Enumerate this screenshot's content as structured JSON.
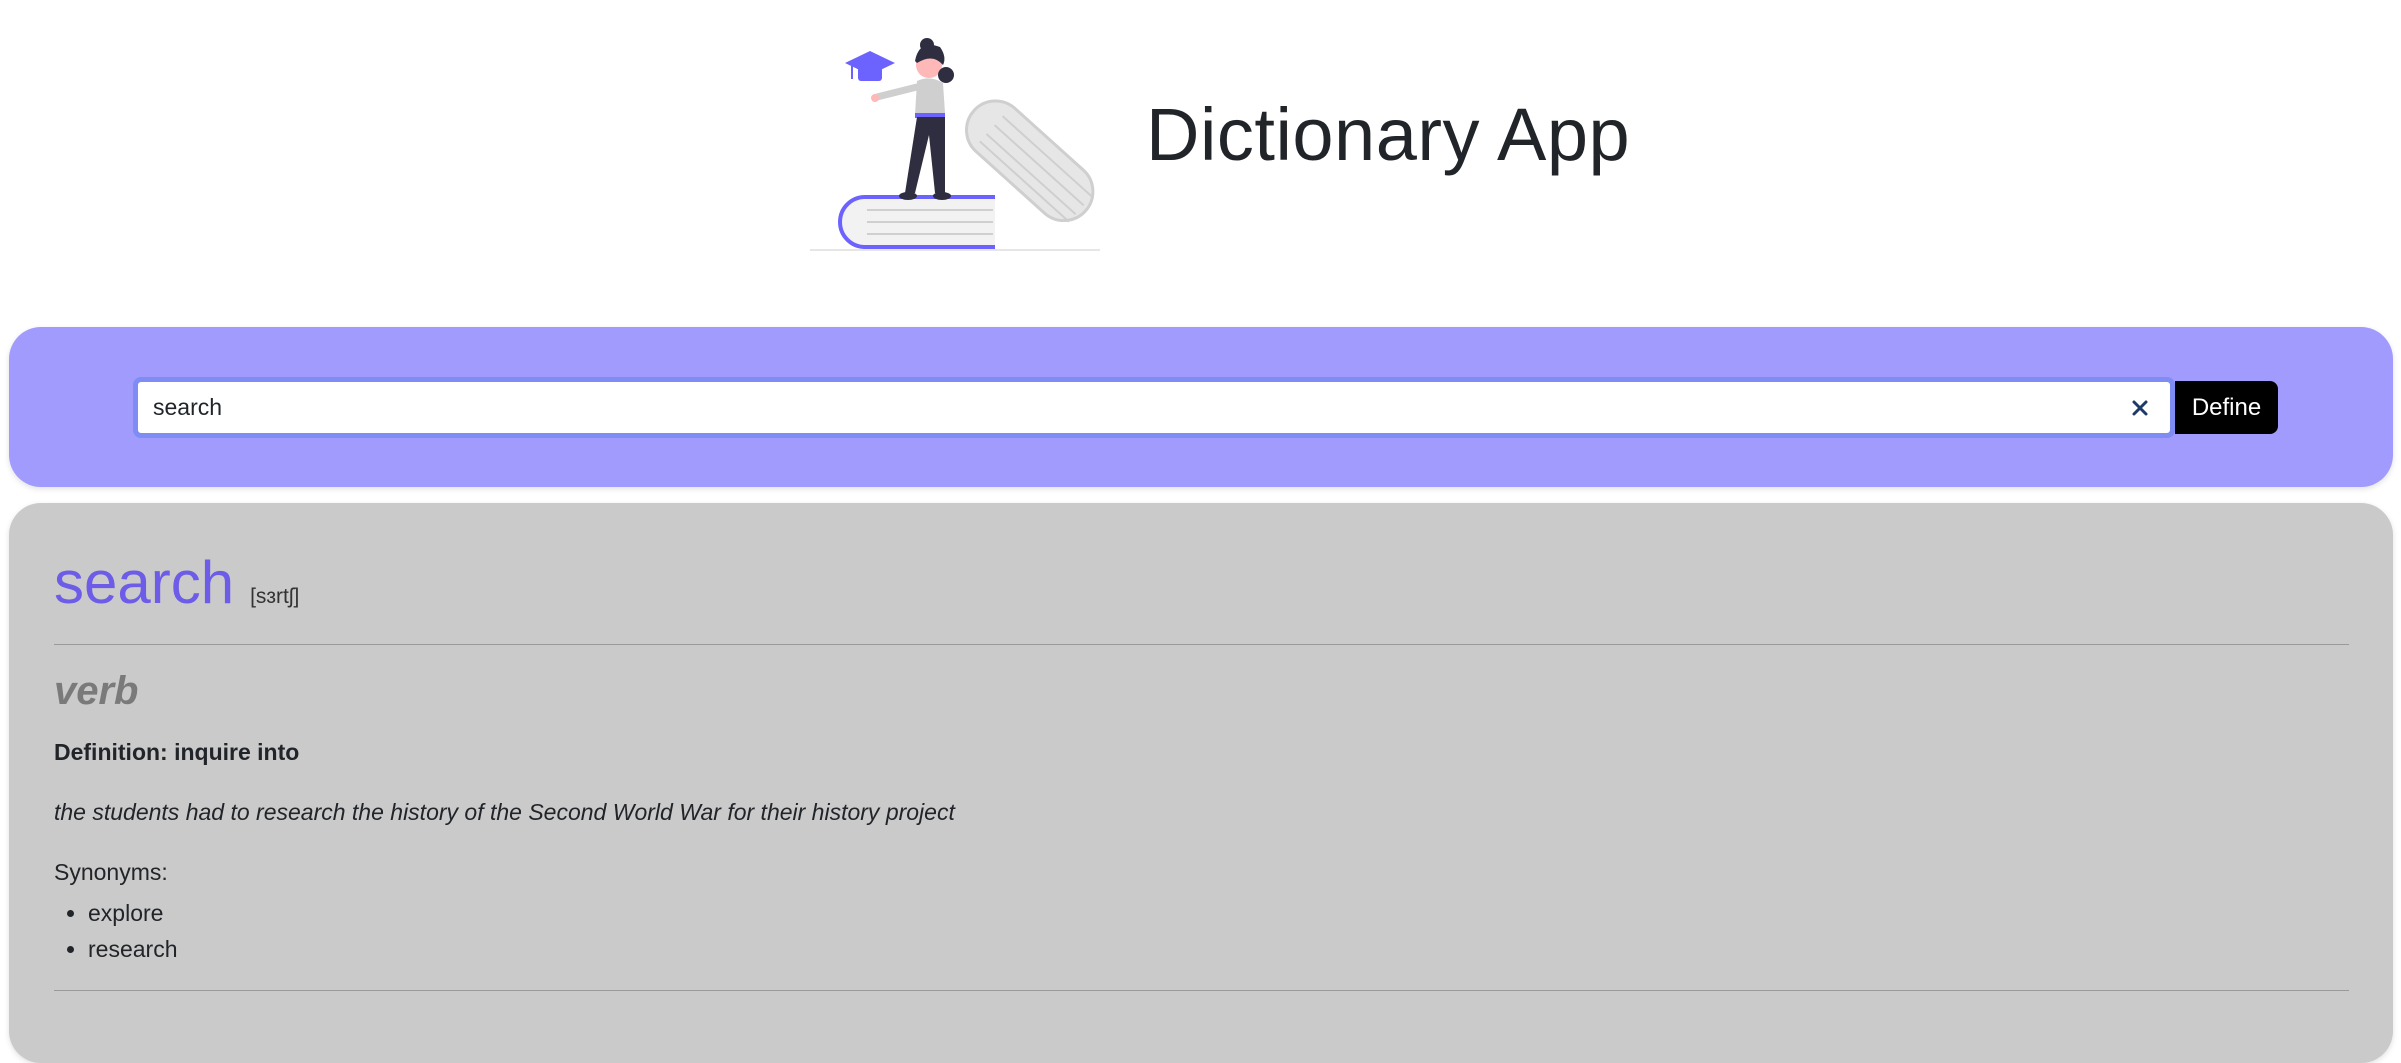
{
  "header": {
    "title": "Dictionary App",
    "illustration_icon": "student-on-books-illustration"
  },
  "search": {
    "value": "search",
    "placeholder": "",
    "clear_icon": "close-icon",
    "define_label": "Define"
  },
  "result": {
    "word": "search",
    "phonetic": "[sɜrtʃ]",
    "part_of_speech": "verb",
    "definition": "Definition: inquire into",
    "example": "the students had to research the history of the Second World War for their history project",
    "synonyms_label": "Synonyms:",
    "synonyms": [
      "explore",
      "research"
    ]
  },
  "colors": {
    "accent": "#6c5ce7",
    "search_panel": "#a29bfe",
    "results_panel": "#cacaca",
    "input_border": "#7f8cf3",
    "button": "#000000"
  }
}
